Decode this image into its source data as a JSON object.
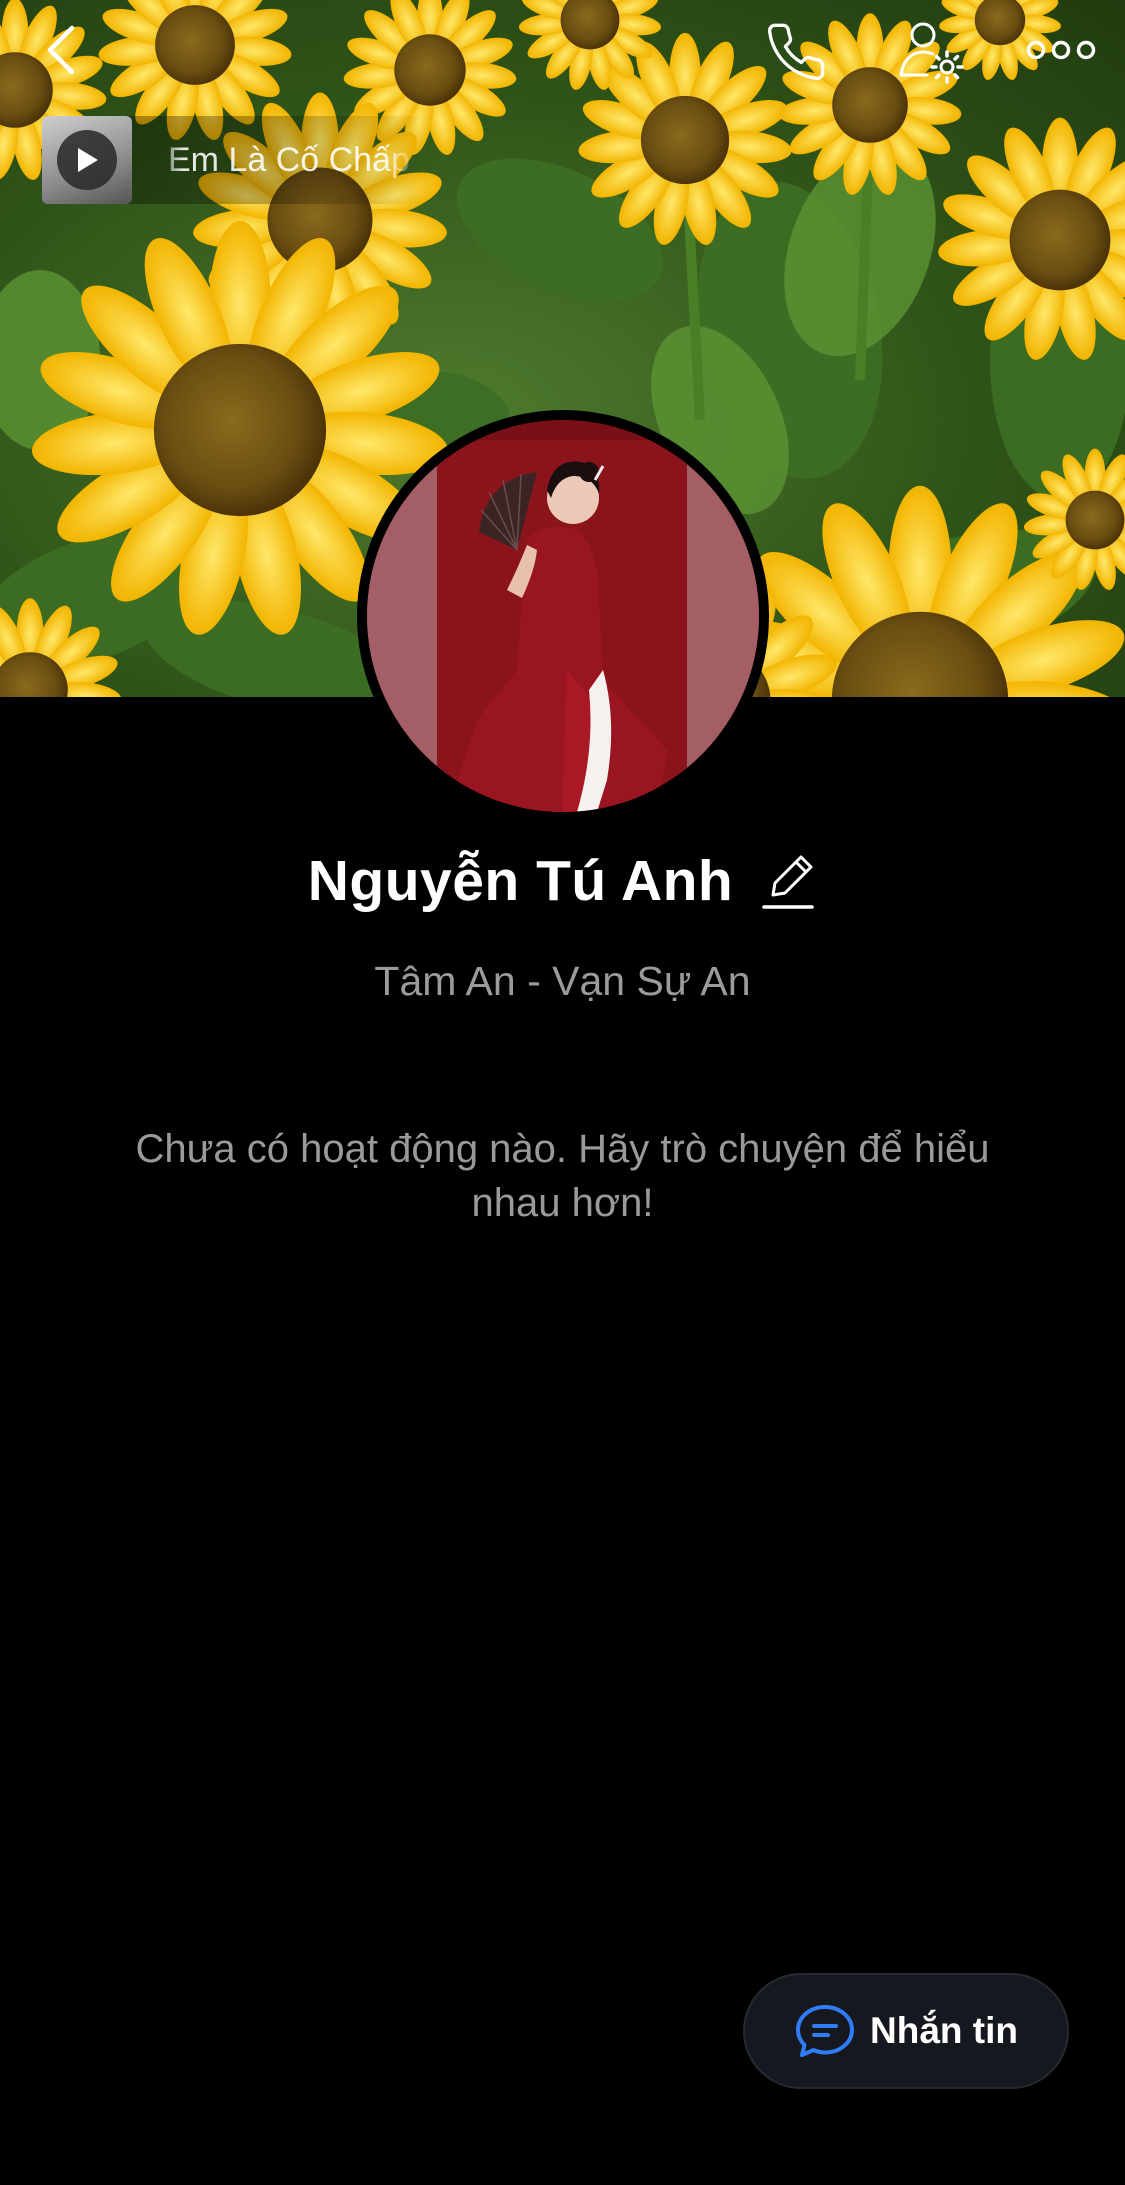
{
  "header": {
    "back_icon": "chevron-left-icon",
    "call_icon": "phone-icon",
    "settings_icon": "user-settings-icon",
    "more_icon": "more-horizontal-icon"
  },
  "music": {
    "title": "Em Là Cố Chấp",
    "play_icon": "play-icon"
  },
  "profile": {
    "name": "Nguyễn Tú Anh",
    "edit_icon": "pencil-icon",
    "status": "Tâm An - Vạn Sự An"
  },
  "activity": {
    "empty_message": "Chưa có hoạt động nào. Hãy trò chuyện để hiểu nhau hơn!"
  },
  "message_button": {
    "label": "Nhắn tin",
    "icon": "chat-bubble-icon",
    "accent": "#2f7cf6"
  }
}
